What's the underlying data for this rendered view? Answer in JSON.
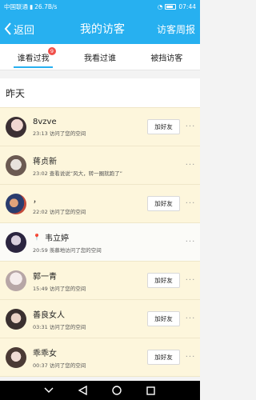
{
  "status_bar": {
    "carrier": "中国联通",
    "speed": "26.7B/s",
    "time": "07:44"
  },
  "header": {
    "back_label": "返回",
    "title": "我的访客",
    "right_label": "访客周报"
  },
  "tabs": [
    {
      "label": "谁看过我",
      "badge": "9",
      "active": true
    },
    {
      "label": "我看过谁",
      "active": false
    },
    {
      "label": "被挡访客",
      "active": false
    }
  ],
  "section_title": "昨天",
  "add_friend_label": "加好友",
  "visitors": [
    {
      "name": "8vzve",
      "time": "23:13",
      "action": "访问了您的空间",
      "show_add": true
    },
    {
      "name": "蒋贞新",
      "time": "23:02",
      "action": "查看说说“风大，转一圈就跑了”",
      "show_add": false
    },
    {
      "name": "，",
      "time": "22:02",
      "action": "访问了您的空间",
      "show_add": true
    },
    {
      "name": "韦立婷",
      "time": "20:59",
      "action": "羡慕地访问了您的空间",
      "show_add": false
    },
    {
      "name": "郭一青",
      "time": "15:49",
      "action": "访问了您的空间",
      "show_add": true
    },
    {
      "name": "善良女人",
      "time": "03:31",
      "action": "访问了您的空间",
      "show_add": true
    },
    {
      "name": "乖乖女",
      "time": "00:37",
      "action": "访问了您的空间",
      "show_add": true
    }
  ],
  "icons": {
    "back": "chevron-left-icon",
    "more": "more-dots-icon",
    "pin": "pin-icon",
    "nav_hide": "chevron-down-icon",
    "nav_back": "triangle-back-icon",
    "nav_home": "circle-home-icon",
    "nav_recents": "square-recents-icon"
  },
  "colors": {
    "brand": "#27b0f0",
    "row_highlight": "#fdf6dc",
    "badge": "#f0504b"
  }
}
